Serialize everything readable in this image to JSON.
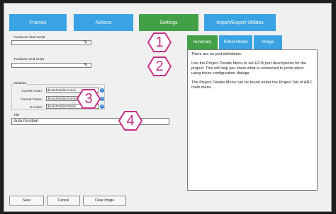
{
  "tabs": [
    {
      "label": "Frames"
    },
    {
      "label": "Actions"
    },
    {
      "label": "Settings"
    },
    {
      "label": "Import/Export Utilities"
    }
  ],
  "settings": {
    "start_script_label": "Positioner Start Script",
    "end_script_label": "Positioner End Script",
    "variables_label": "Variables",
    "current_action_label": "Current Action:",
    "current_action_value": "$AutoPositionAction",
    "current_frame_label": "Current Frame:",
    "current_frame_value": "$AutoPositionFrame",
    "is_active_label": "Is Active:",
    "is_active_value": "$AutoPositionStatus",
    "title_label": "Title",
    "title_value": "Auto Position",
    "info_glyph": "?",
    "edit_icon": "pencil-icon"
  },
  "project_panel": {
    "tabs": [
      {
        "label": "Summary"
      },
      {
        "label": "Robot Model"
      },
      {
        "label": "Image"
      }
    ],
    "paragraphs": [
      "There are no port definitions.",
      "Use the Project Details Menu to set EZ-B port descriptions for the project. This will help you know what is connected to ports when using these configuration dialogs.",
      "The Project Details Menu can be found under the Project Tab of ARC main menu."
    ]
  },
  "buttons": {
    "save": "Save",
    "cancel": "Cancel",
    "clear_image": "Clear Image"
  },
  "callouts": [
    "1",
    "2",
    "3",
    "4"
  ],
  "colors": {
    "tab_blue": "#3aa3e3",
    "tab_green": "#43a047",
    "callout": "#c62f86",
    "info_blue": "#2f7fd1"
  }
}
